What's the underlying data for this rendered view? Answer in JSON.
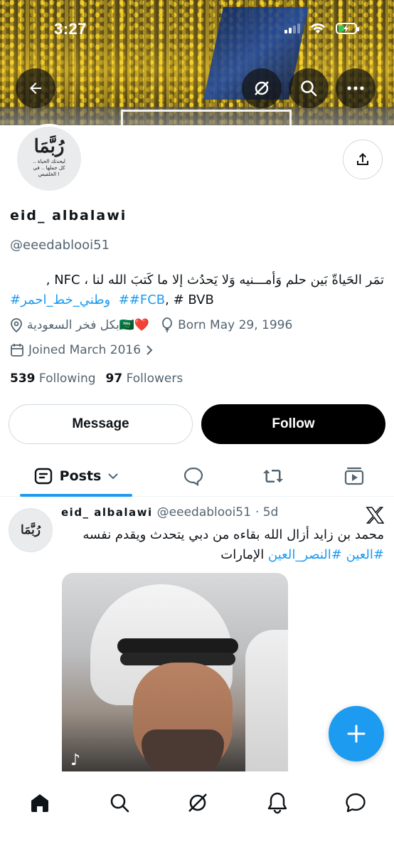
{
  "status_bar": {
    "time": "3:27"
  },
  "profile": {
    "display_name": "eid_ albalawi",
    "handle": "@eeedablooi51",
    "bio": {
      "line1_text": "تمَر الحَياةّ بَين حلم وَأمـــنيه وَلا يَحدُث إلا ما كَتبَ الله لنا ، NFC ,",
      "hashtag_rtl": "#وطني_خط_احمر",
      "hashtag_fcb": "##FCB",
      "rest": ", # BVB"
    },
    "location": "بكل فخر السعودية🇸🇦❤️",
    "born": "Born May 29, 1996",
    "joined": "Joined March 2016",
    "following_count": "539",
    "following_label": "Following",
    "followers_count": "97",
    "followers_label": "Followers",
    "avatar_text_main": "رُبَّمَا",
    "avatar_text_sub": "ليحدثك الحياة .. كل جملها .. في الخلفيص !"
  },
  "buttons": {
    "message": "Message",
    "follow": "Follow"
  },
  "tabs": {
    "posts": "Posts"
  },
  "post": {
    "name": "eid_ albalawi",
    "handle": "@eeedablooi51",
    "time": "· 5d",
    "text_plain": "محمد بن زايد أزال الله بقاءه من دبي يتحدث ويقدم نفسه",
    "hashtag1": "#العين",
    "hashtag2": "#النصر_العين",
    "text_end": "الإمارات"
  },
  "icons": {
    "back": "arrow-left-icon",
    "grok": "grok-icon",
    "search": "search-icon",
    "more": "more-icon",
    "share": "share-icon",
    "location": "location-pin-icon",
    "birthday": "balloon-icon",
    "calendar": "calendar-icon",
    "x_logo": "x-logo-icon",
    "compose": "plus-icon"
  },
  "colors": {
    "accent": "#1d9bf0",
    "text": "#0f1419",
    "secondary": "#536471",
    "follow_bg": "#000000"
  }
}
